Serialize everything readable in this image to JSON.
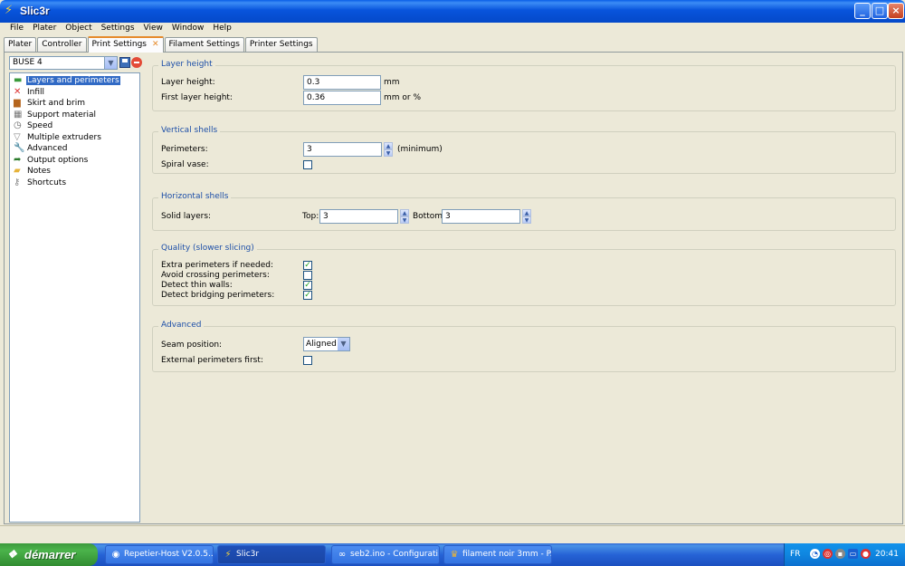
{
  "window": {
    "title": "Slic3r"
  },
  "menu": [
    "File",
    "Plater",
    "Object",
    "Settings",
    "View",
    "Window",
    "Help"
  ],
  "tabs": [
    {
      "label": "Plater"
    },
    {
      "label": "Controller"
    },
    {
      "label": "Print Settings",
      "closable": true
    },
    {
      "label": "Filament Settings"
    },
    {
      "label": "Printer Settings"
    }
  ],
  "preset": {
    "value": "BUSE 4"
  },
  "tree": [
    {
      "label": "Layers and perimeters",
      "icon": "layers-icon"
    },
    {
      "label": "Infill",
      "icon": "infill-icon"
    },
    {
      "label": "Skirt and brim",
      "icon": "skirt-icon"
    },
    {
      "label": "Support material",
      "icon": "support-icon"
    },
    {
      "label": "Speed",
      "icon": "speed-icon"
    },
    {
      "label": "Multiple extruders",
      "icon": "funnel-icon"
    },
    {
      "label": "Advanced",
      "icon": "wrench-icon"
    },
    {
      "label": "Output options",
      "icon": "output-icon"
    },
    {
      "label": "Notes",
      "icon": "folder-icon"
    },
    {
      "label": "Shortcuts",
      "icon": "key-icon"
    }
  ],
  "groups": {
    "layer_height": {
      "title": "Layer height",
      "layer_height_label": "Layer height:",
      "layer_height_value": "0.3",
      "layer_height_unit": "mm",
      "first_layer_label": "First layer height:",
      "first_layer_value": "0.36",
      "first_layer_unit": "mm or %"
    },
    "vertical_shells": {
      "title": "Vertical shells",
      "perimeters_label": "Perimeters:",
      "perimeters_value": "3",
      "perimeters_unit": "(minimum)",
      "spiral_label": "Spiral vase:",
      "spiral_checked": false
    },
    "horizontal_shells": {
      "title": "Horizontal shells",
      "solid_label": "Solid layers:",
      "top_label": "Top:",
      "top_value": "3",
      "bottom_label": "Bottom:",
      "bottom_value": "3"
    },
    "quality": {
      "title": "Quality (slower slicing)",
      "extra_label": "Extra perimeters if needed:",
      "extra_checked": true,
      "avoid_label": "Avoid crossing perimeters:",
      "avoid_checked": false,
      "thin_label": "Detect thin walls:",
      "thin_checked": true,
      "bridging_label": "Detect bridging perimeters:",
      "bridging_checked": true
    },
    "advanced": {
      "title": "Advanced",
      "seam_label": "Seam position:",
      "seam_value": "Aligned",
      "external_label": "External perimeters first:",
      "external_checked": false
    }
  },
  "taskbar": {
    "start_label": "démarrer",
    "tasks": [
      {
        "label": "Repetier-Host V2.0.5...",
        "icon": "repetier-icon"
      },
      {
        "label": "Slic3r",
        "icon": "slic3r-icon"
      },
      {
        "label": "seb2.ino - Configurati...",
        "icon": "arduino-icon"
      },
      {
        "label": "filament noir 3mm - P...",
        "icon": "browser-icon"
      }
    ],
    "language": "FR",
    "clock": "20:41"
  },
  "colors": {
    "accent": "#316ac5",
    "group_title": "#1d4fa8",
    "tab_highlight": "#e68b2c"
  }
}
